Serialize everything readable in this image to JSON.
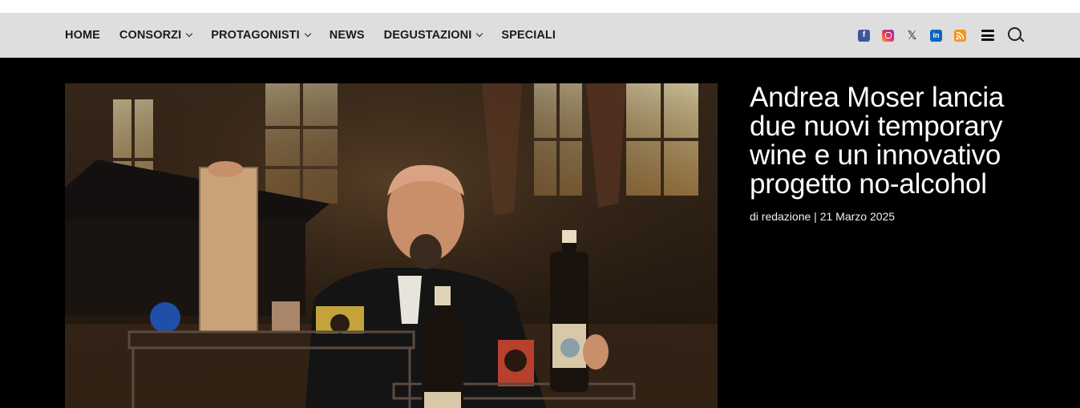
{
  "nav": {
    "items": [
      {
        "label": "HOME",
        "has_dropdown": false
      },
      {
        "label": "CONSORZI",
        "has_dropdown": true
      },
      {
        "label": "PROTAGONISTI",
        "has_dropdown": true
      },
      {
        "label": "NEWS",
        "has_dropdown": false
      },
      {
        "label": "DEGUSTAZIONI",
        "has_dropdown": true
      },
      {
        "label": "SPECIALI",
        "has_dropdown": false
      }
    ]
  },
  "social": {
    "facebook": "f",
    "x": "𝕏",
    "linkedin": "in"
  },
  "icons": [
    "facebook-icon",
    "instagram-icon",
    "x-icon",
    "linkedin-icon",
    "rss-icon",
    "menu-icon",
    "search-icon"
  ],
  "article": {
    "title": "Andrea Moser lancia due nuovi temporary wine e un innovativo progetto no-alcohol",
    "meta": "di redazione | 21 Marzo 2025"
  },
  "colors": {
    "navbar_bg": "#dedede",
    "page_bg": "#000000",
    "text_light": "#ffffff"
  }
}
